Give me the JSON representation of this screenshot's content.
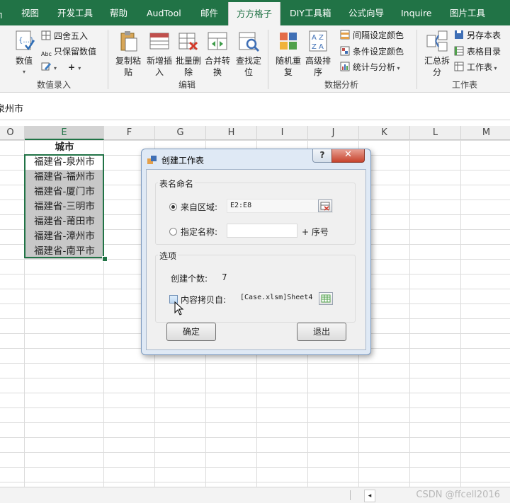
{
  "tabs": [
    {
      "label": "┐"
    },
    {
      "label": "视图"
    },
    {
      "label": "开发工具"
    },
    {
      "label": "帮助"
    },
    {
      "label": "AudTool"
    },
    {
      "label": "邮件"
    },
    {
      "label": "方方格子"
    },
    {
      "label": "DIY工具箱"
    },
    {
      "label": "公式向导"
    },
    {
      "label": "Inquire"
    },
    {
      "label": "图片工具"
    }
  ],
  "ribbon": {
    "numeric_entry": {
      "group_label": "数值录入",
      "value_button": "数值",
      "round_button": "四舍五入",
      "keep_value_button": "只保留数值",
      "plus_button": "+"
    },
    "edit": {
      "group_label": "编辑",
      "copy_paste": "复制粘\n贴",
      "insert": "新增插\n入",
      "batch_delete": "批量删\n除",
      "merge_convert": "合并转\n换",
      "find_locate": "查找定\n位"
    },
    "analysis": {
      "group_label": "数据分析",
      "random_repeat": "随机重\n复",
      "advanced_sort": "高级排\n序",
      "interval_color": "间隔设定颜色",
      "cond_color": "条件设定颜色",
      "stats": "统计与分析"
    },
    "worksheet": {
      "group_label": "工作表",
      "summary_split": "汇总拆\n分",
      "save_as": "另存本表",
      "table_dir": "表格目录",
      "worksheet_menu": "工作表"
    }
  },
  "formula_bar": {
    "value": "泉州市"
  },
  "columns": [
    "O",
    "E",
    "F",
    "G",
    "H",
    "I",
    "J",
    "K",
    "L",
    "M"
  ],
  "cells": {
    "header": "城市",
    "rows": [
      "福建省-泉州市",
      "福建省-福州市",
      "福建省-厦门市",
      "福建省-三明市",
      "福建省-莆田市",
      "福建省-漳州市",
      "福建省-南平市"
    ]
  },
  "dialog": {
    "title": "创建工作表",
    "help": "?",
    "close": "✕",
    "naming_legend": "表名命名",
    "from_range_label": "来自区域:",
    "from_range_value": "E2:E8",
    "specify_name_label": "指定名称:",
    "specify_name_value": "",
    "plus_seq": "+ 序号",
    "options_legend": "选项",
    "create_count_label": "创建个数:",
    "create_count_value": "7",
    "copy_from_label": "内容拷贝自:",
    "copy_from_value": "[Case.xlsm]Sheet4",
    "ok": "确定",
    "exit": "退出"
  },
  "watermark": "CSDN @ffcell2016",
  "colors": {
    "excel_green": "#217346",
    "selection": "#c8c8c8"
  }
}
